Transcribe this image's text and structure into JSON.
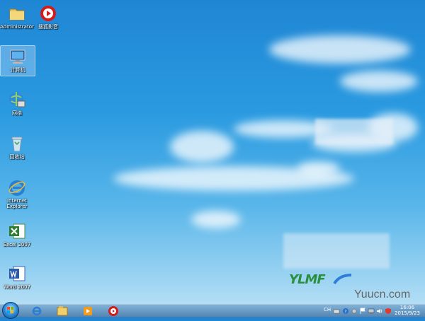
{
  "desktop": {
    "icons": [
      {
        "label": "Administrator",
        "icon": "folder-icon"
      },
      {
        "label": "搜狐影音",
        "icon": "sohu-video-icon"
      },
      {
        "label": "计算机",
        "icon": "computer-icon"
      },
      {
        "label": "网络",
        "icon": "network-icon"
      },
      {
        "label": "回收站",
        "icon": "recycle-bin-icon"
      },
      {
        "label": "Internet Explorer",
        "icon": "internet-explorer-icon"
      },
      {
        "label": "Excel 2007",
        "icon": "excel-icon"
      },
      {
        "label": "Word 2007",
        "icon": "word-icon"
      }
    ]
  },
  "logo": {
    "text": "YLMF"
  },
  "watermark": "Yuucn.com",
  "taskbar": {
    "pinned": [
      "internet-explorer-icon",
      "file-explorer-icon",
      "media-player-icon",
      "sohu-video-icon"
    ],
    "tray": {
      "language": "CH"
    },
    "clock": {
      "time": "16:06",
      "date": "2015/9/23"
    }
  }
}
